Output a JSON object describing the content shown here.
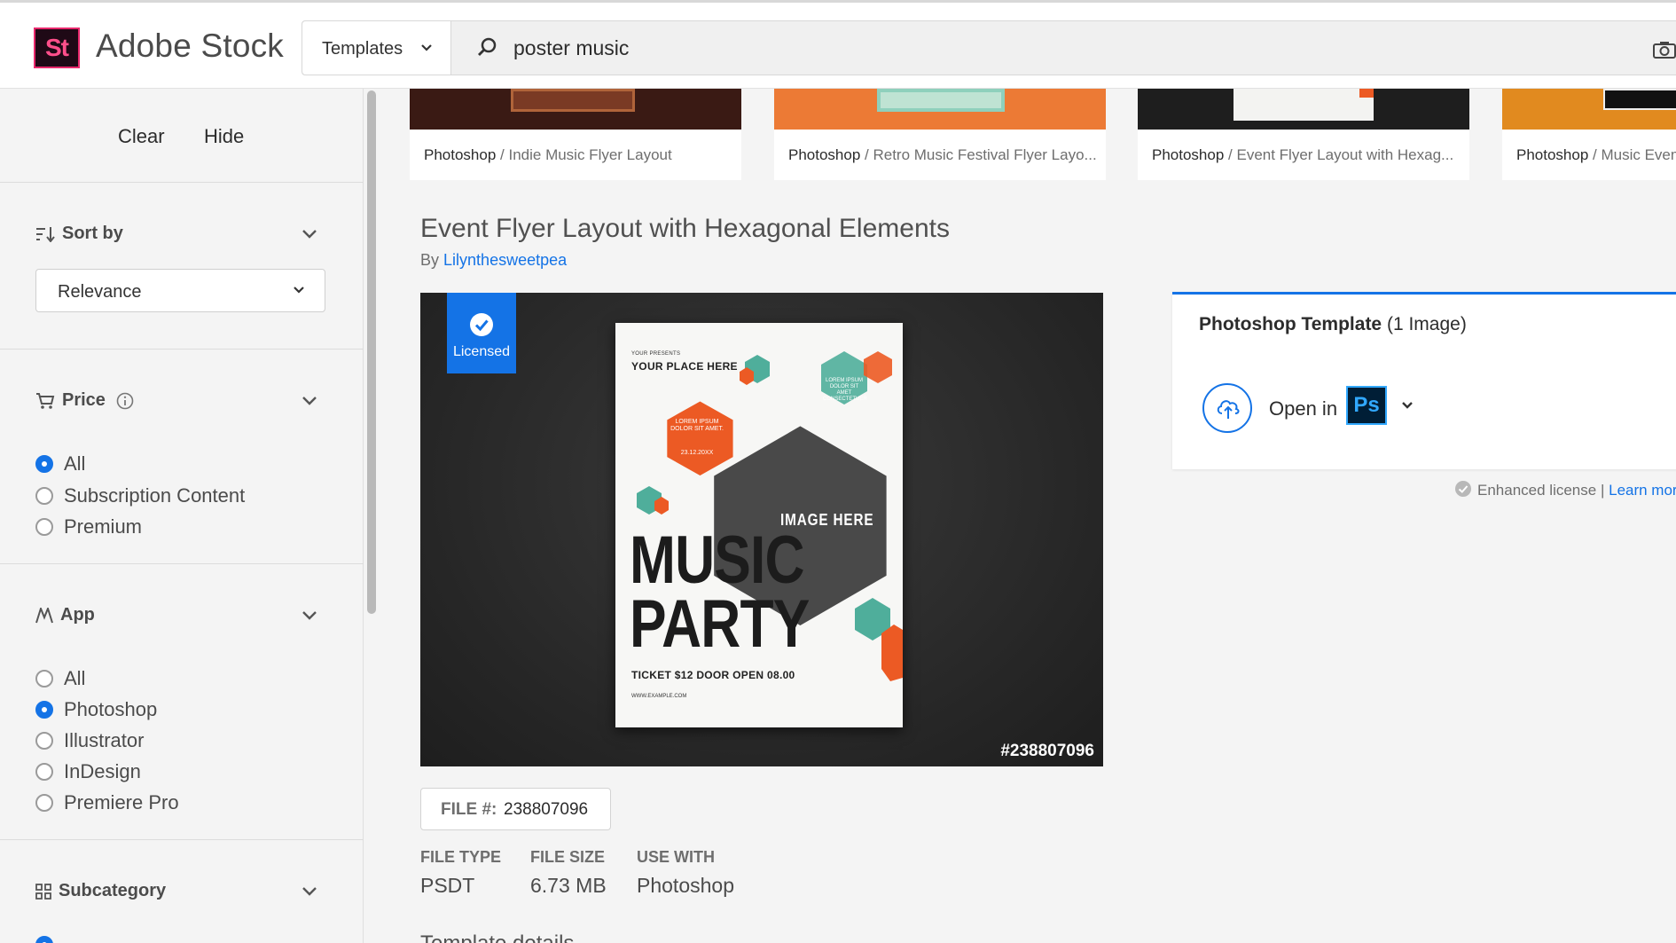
{
  "header": {
    "logo_mark": "St",
    "logo_text": "Adobe Stock",
    "search_type": "Templates",
    "search_query": "poster music"
  },
  "sidebar": {
    "clear_label": "Clear",
    "hide_label": "Hide",
    "sort": {
      "title": "Sort by",
      "selected": "Relevance"
    },
    "price": {
      "title": "Price",
      "options": [
        {
          "label": "All",
          "checked": true
        },
        {
          "label": "Subscription Content",
          "checked": false
        },
        {
          "label": "Premium",
          "checked": false
        }
      ]
    },
    "app": {
      "title": "App",
      "options": [
        {
          "label": "All",
          "checked": false
        },
        {
          "label": "Photoshop",
          "checked": true
        },
        {
          "label": "Illustrator",
          "checked": false
        },
        {
          "label": "InDesign",
          "checked": false
        },
        {
          "label": "Premiere Pro",
          "checked": false
        }
      ]
    },
    "subcategory": {
      "title": "Subcategory"
    }
  },
  "thumbnails": [
    {
      "app": "Photoshop",
      "name": "/ Indie Music Flyer Layout",
      "color": "#3a1a14"
    },
    {
      "app": "Photoshop",
      "name": "/ Retro Music Festival Flyer Layo...",
      "color": "#ec7a35"
    },
    {
      "app": "Photoshop",
      "name": "/ Event Flyer Layout with Hexag...",
      "color": "#1e1e1e"
    },
    {
      "app": "Photoshop",
      "name": "/ Music Even",
      "color": "#e18a1f"
    }
  ],
  "asset": {
    "title": "Event Flyer Layout with Hexagonal Elements",
    "by_label": "By",
    "author": "Lilynthesweetpea",
    "licensed_label": "Licensed",
    "file_id_overlay": "#238807096",
    "file_label": "FILE #:",
    "file_number": "238807096",
    "meta": [
      {
        "key": "FILE TYPE",
        "value": "PSDT"
      },
      {
        "key": "FILE SIZE",
        "value": "6.73 MB"
      },
      {
        "key": "USE WITH",
        "value": "Photoshop"
      }
    ],
    "details_heading": "Template details"
  },
  "poster": {
    "presents": "YOUR PRESENTS",
    "place": "YOUR PLACE HERE",
    "hex_text_1": "LOREM IPSUM DOLOR SIT AMET.",
    "date": "23.12.20XX",
    "hex_text_2": "LOREM IPSUM DOLOR SIT AMET CONSECTETUER",
    "image_here": "IMAGE HERE",
    "line1": "MUSIC",
    "line2": "PARTY",
    "ticket": "TICKET $12 DOOR OPEN 08.00",
    "website": "WWW.EXAMPLE.COM"
  },
  "panel": {
    "title_bold": "Photoshop Template",
    "title_rest": "(1 Image)",
    "open_in": "Open in",
    "app_badge": "Ps"
  },
  "license_note": {
    "text": "Enhanced license",
    "sep": "|",
    "link": "Learn mor"
  },
  "colors": {
    "accent": "#1473e6",
    "brand": "#e8286c",
    "ps_blue": "#31a8ff",
    "hex_orange": "#ec5a24",
    "hex_teal": "#4fae9b"
  }
}
